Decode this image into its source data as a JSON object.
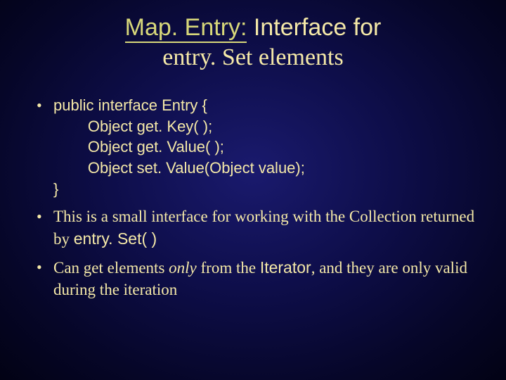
{
  "title": {
    "code": "Map. Entry:",
    "rest": " Interface for",
    "line2": "entry. Set elements"
  },
  "bullets": {
    "b1": {
      "l1": "public interface Entry {",
      "l2": "        Object get. Key( );",
      "l3": "        Object get. Value( );",
      "l4": "        Object set. Value(Object value);",
      "l5": "}"
    },
    "b2": {
      "t1": "This is a small interface for working with the Collection returned by ",
      "code": "entry. Set( )"
    },
    "b3": {
      "t1": "Can get elements ",
      "only": "only",
      "t2": " from the ",
      "iter": "Iterator",
      "t3": ", and they are only valid during the iteration"
    }
  }
}
